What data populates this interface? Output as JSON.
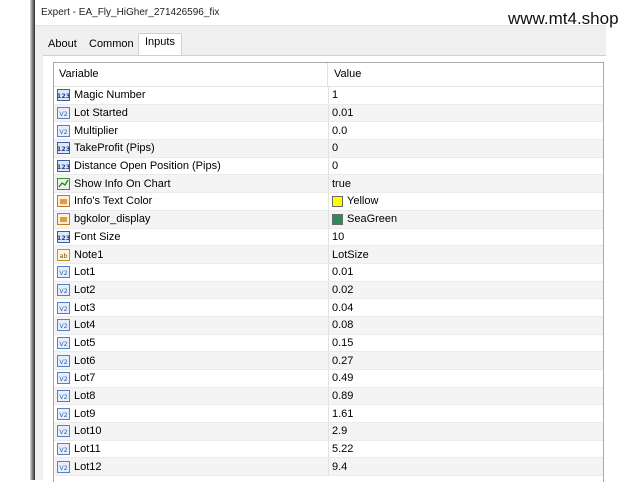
{
  "window": {
    "title": "Expert - EA_Fly_HiGher_271426596_fix",
    "watermark": "www.mt4.shop"
  },
  "tabs": [
    {
      "label": "About",
      "active": false
    },
    {
      "label": "Common",
      "active": false
    },
    {
      "label": "Inputs",
      "active": true
    }
  ],
  "grid": {
    "headers": {
      "variable": "Variable",
      "value": "Value"
    },
    "rows": [
      {
        "icon": "integer-icon",
        "variable": "Magic Number",
        "value": "1"
      },
      {
        "icon": "double-icon",
        "variable": "Lot Started",
        "value": "0.01"
      },
      {
        "icon": "double-icon",
        "variable": "Multiplier",
        "value": "0.0"
      },
      {
        "icon": "integer-icon",
        "variable": "TakeProfit (Pips)",
        "value": "0"
      },
      {
        "icon": "integer-icon",
        "variable": "Distance Open Position (Pips)",
        "value": "0"
      },
      {
        "icon": "bool-icon",
        "variable": "Show Info On Chart",
        "value": "true"
      },
      {
        "icon": "color-icon",
        "variable": "Info's Text Color",
        "value": "Yellow",
        "swatch": "#ffff00"
      },
      {
        "icon": "color-icon",
        "variable": "bgkolor_display",
        "value": "SeaGreen",
        "swatch": "#2e8b57"
      },
      {
        "icon": "integer-icon",
        "variable": "Font Size",
        "value": "10"
      },
      {
        "icon": "string-icon",
        "variable": "Note1",
        "value": "LotSize"
      },
      {
        "icon": "double-icon",
        "variable": "Lot1",
        "value": "0.01"
      },
      {
        "icon": "double-icon",
        "variable": "Lot2",
        "value": "0.02"
      },
      {
        "icon": "double-icon",
        "variable": "Lot3",
        "value": "0.04"
      },
      {
        "icon": "double-icon",
        "variable": "Lot4",
        "value": "0.08"
      },
      {
        "icon": "double-icon",
        "variable": "Lot5",
        "value": "0.15"
      },
      {
        "icon": "double-icon",
        "variable": "Lot6",
        "value": "0.27"
      },
      {
        "icon": "double-icon",
        "variable": "Lot7",
        "value": "0.49"
      },
      {
        "icon": "double-icon",
        "variable": "Lot8",
        "value": "0.89"
      },
      {
        "icon": "double-icon",
        "variable": "Lot9",
        "value": "1.61"
      },
      {
        "icon": "double-icon",
        "variable": "Lot10",
        "value": "2.9"
      },
      {
        "icon": "double-icon",
        "variable": "Lot11",
        "value": "5.22"
      },
      {
        "icon": "double-icon",
        "variable": "Lot12",
        "value": "9.4"
      }
    ]
  },
  "colors": {
    "dialog_bg": "#f0f0f0",
    "grid_bg": "#ffffff",
    "row_alt": "#f4f4f4"
  }
}
